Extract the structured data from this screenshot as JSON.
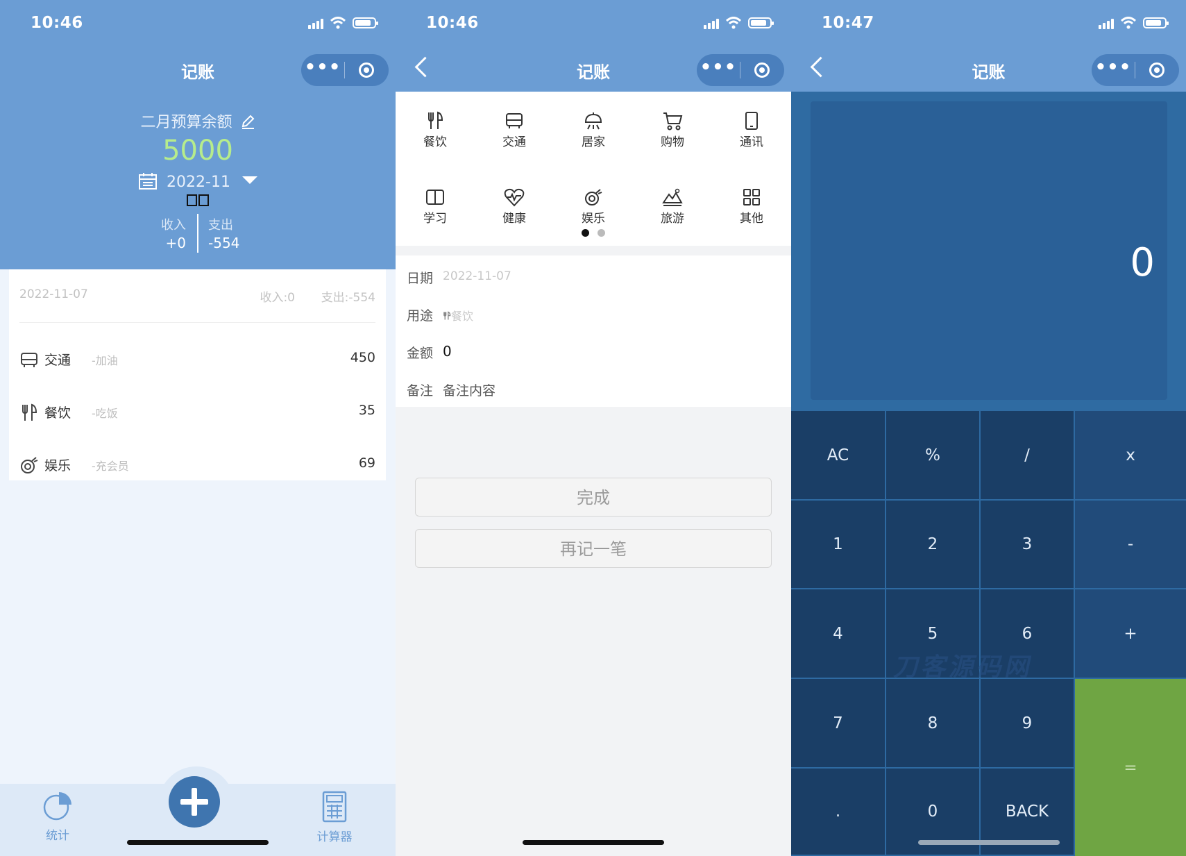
{
  "screen_list": {
    "status": {
      "time": "10:46"
    },
    "nav": {
      "title": "记账",
      "more_label": "•••"
    },
    "budget": {
      "label": "二月预算余额",
      "value": "5000",
      "month": "2022-11",
      "missing_glyphs": "□□"
    },
    "summary": {
      "income_label": "收入",
      "income_value": "+0",
      "expense_label": "支出",
      "expense_value": "-554"
    },
    "day": {
      "date": "2022-11-07",
      "income": "收入:0",
      "expense": "支出:-554"
    },
    "records": [
      {
        "icon": "bus-icon",
        "category": "交通",
        "note": "-加油",
        "amount": "450"
      },
      {
        "icon": "utensils-icon",
        "category": "餐饮",
        "note": "-吃饭",
        "amount": "35"
      },
      {
        "icon": "entertainment-icon",
        "category": "娱乐",
        "note": "-充会员",
        "amount": "69"
      }
    ],
    "tabs": {
      "stats": "统计",
      "calculator": "计算器"
    }
  },
  "screen_add": {
    "status": {
      "time": "10:46"
    },
    "nav": {
      "title": "记账",
      "more_label": "•••"
    },
    "categories": [
      {
        "icon": "utensils-icon",
        "label": "餐饮"
      },
      {
        "icon": "bus-icon",
        "label": "交通"
      },
      {
        "icon": "home-lamp-icon",
        "label": "居家"
      },
      {
        "icon": "cart-icon",
        "label": "购物"
      },
      {
        "icon": "phone-icon",
        "label": "通讯"
      },
      {
        "icon": "book-icon",
        "label": "学习"
      },
      {
        "icon": "heart-pulse-icon",
        "label": "健康"
      },
      {
        "icon": "entertainment-icon",
        "label": "娱乐"
      },
      {
        "icon": "travel-icon",
        "label": "旅游"
      },
      {
        "icon": "grid-icon",
        "label": "其他"
      }
    ],
    "form": {
      "date_label": "日期",
      "date_value": "2022-11-07",
      "purpose_label": "用途",
      "purpose_value": "餐饮",
      "amount_label": "金额",
      "amount_value": "0",
      "remark_label": "备注",
      "remark_placeholder": "备注内容"
    },
    "buttons": {
      "done": "完成",
      "again": "再记一笔"
    }
  },
  "screen_calc": {
    "status": {
      "time": "10:47"
    },
    "nav": {
      "title": "记账",
      "more_label": "•••"
    },
    "display": "0",
    "keys": {
      "ac": "AC",
      "pct": "%",
      "div": "/",
      "mul": "x",
      "k1": "1",
      "k2": "2",
      "k3": "3",
      "minus": "-",
      "k4": "4",
      "k5": "5",
      "k6": "6",
      "plus": "+",
      "k7": "7",
      "k8": "8",
      "k9": "9",
      "eq": "=",
      "dot": ".",
      "k0": "0",
      "back": "BACK"
    },
    "watermark": "刀客源码网"
  },
  "colors": {
    "primary": "#6b9dd4",
    "fab": "#3f75af",
    "budget_value": "#b6ec8c",
    "equals": "#6fa543",
    "key_dark": "#1a3e66"
  }
}
